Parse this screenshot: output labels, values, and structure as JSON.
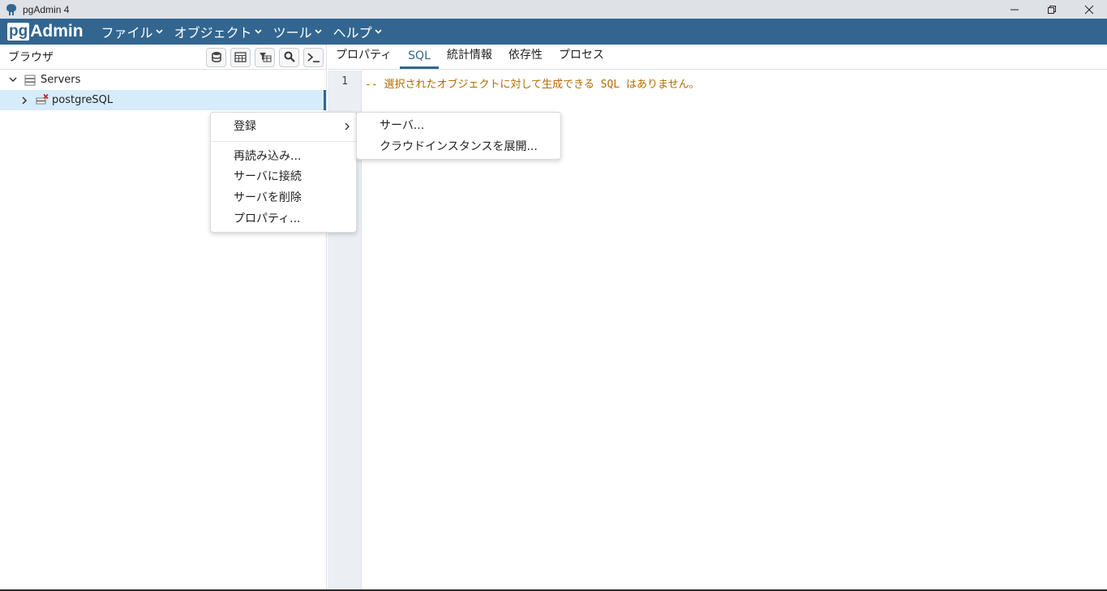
{
  "window": {
    "title": "pgAdmin 4",
    "controls": [
      "minimize-icon",
      "restore-icon",
      "close-icon"
    ]
  },
  "menubar": {
    "logo_pg": "pg",
    "logo_admin": "Admin",
    "menus": [
      {
        "label": "ファイル"
      },
      {
        "label": "オブジェクト"
      },
      {
        "label": "ツール"
      },
      {
        "label": "ヘルプ"
      }
    ]
  },
  "browser": {
    "label": "ブラウザ",
    "toolbar_icons": [
      "database-icon",
      "table-icon",
      "filtered-rows-icon",
      "search-icon",
      "terminal-icon"
    ],
    "tree": {
      "servers_label": "Servers",
      "server_label": "postgreSQL"
    }
  },
  "tabs": [
    {
      "label": "プロパティ",
      "active": false
    },
    {
      "label": "SQL",
      "active": true
    },
    {
      "label": "統計情報",
      "active": false
    },
    {
      "label": "依存性",
      "active": false
    },
    {
      "label": "プロセス",
      "active": false
    }
  ],
  "editor": {
    "line_number": "1",
    "line_text": "-- 選択されたオブジェクトに対して生成できる SQL はありません。"
  },
  "context_menu": {
    "items": [
      {
        "label": "登録",
        "has_submenu": true
      },
      {
        "label": "再読み込み..."
      },
      {
        "label": "サーバに接続"
      },
      {
        "label": "サーバを削除"
      },
      {
        "label": "プロパティ..."
      }
    ],
    "submenu": [
      {
        "label": "サーバ..."
      },
      {
        "label": "クラウドインスタンスを展開..."
      }
    ]
  },
  "colors": {
    "brand": "#326690",
    "comment": "#b26b00",
    "selection": "#d6ecfa",
    "gutter": "#ebeef3"
  }
}
